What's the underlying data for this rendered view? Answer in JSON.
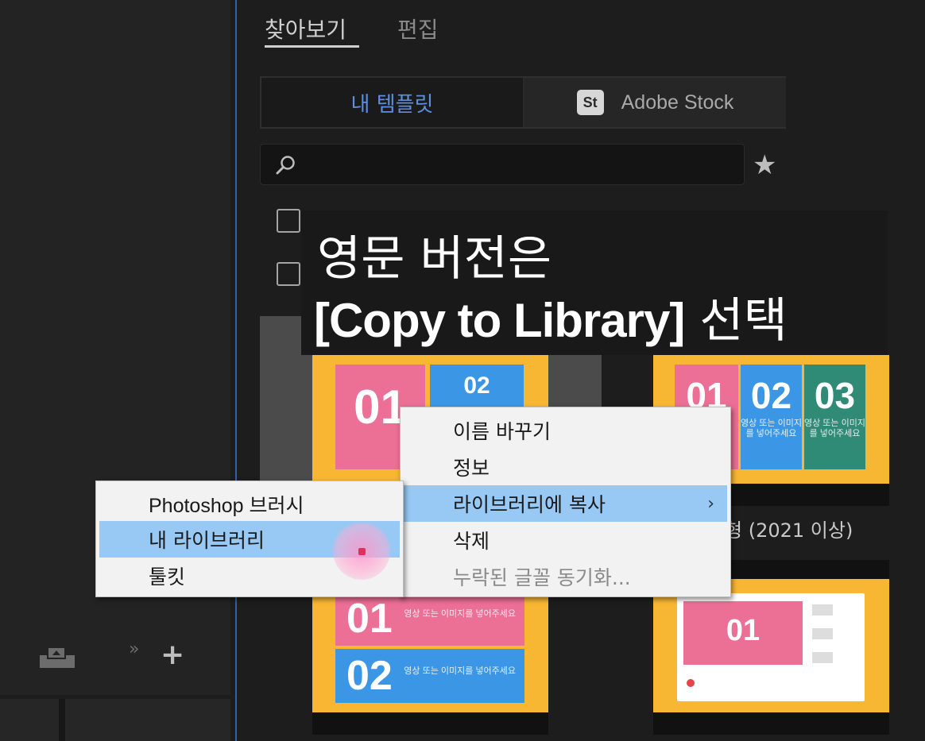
{
  "tabs": {
    "browse": "찾아보기",
    "edit": "편집"
  },
  "segment": {
    "my_templates": "내 템플릿",
    "stock_badge": "St",
    "adobe_stock": "Adobe Stock"
  },
  "search": {
    "placeholder": ""
  },
  "caption": {
    "line1": "영문 버전은",
    "line2_en": "[Copy to Library]",
    "line2_ko": " 선택"
  },
  "thumbnails": {
    "t1": {
      "num1": "01",
      "num2": "02"
    },
    "t2": {
      "num1": "01",
      "num2": "02",
      "num3": "03",
      "sub": "영상 또는 이미지를 넣어주세요"
    },
    "t3": {
      "num1": "01",
      "num2": "02",
      "sub": "영상 또는 이미지를 넣어주세요"
    },
    "t4": {
      "num1": "01"
    },
    "label": "형 (2021 이상)"
  },
  "context_menu": {
    "items": [
      {
        "label": "이름 바꾸기"
      },
      {
        "label": "정보"
      },
      {
        "label": "라이브러리에 복사",
        "arrow": "›"
      },
      {
        "label": "삭제"
      },
      {
        "label": "누락된 글꼴 동기화..."
      }
    ]
  },
  "submenu": {
    "items": [
      {
        "label": "Photoshop 브러시"
      },
      {
        "label": "내 라이브러리"
      },
      {
        "label": "툴킷"
      }
    ]
  },
  "icons": {
    "chevrons": "»",
    "plus": "+",
    "star": "★"
  },
  "colors": {
    "accent_blue": "#5d8fe0",
    "menu_highlight": "#98c8f4",
    "thumb_yellow": "#f7b733",
    "tile_pink": "#ec6f96",
    "tile_blue": "#3b97e6",
    "tile_green": "#2f8a76"
  }
}
